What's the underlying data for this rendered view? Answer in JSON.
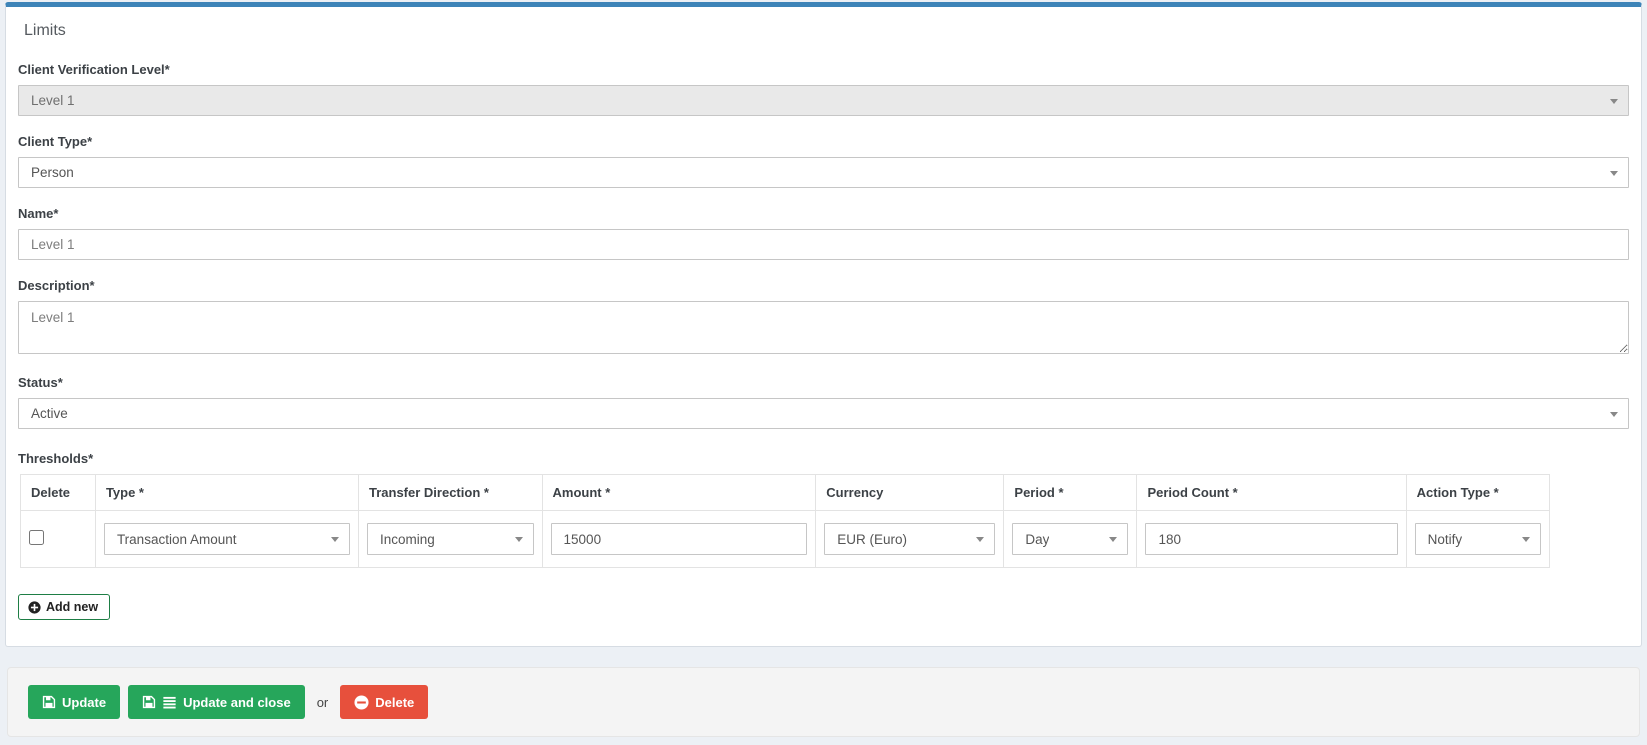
{
  "page": {
    "title": "Limits"
  },
  "colors": {
    "accent_blue": "#3d84b8",
    "success_green": "#26a65b",
    "danger_red": "#e7503c",
    "add_new_border_green": "#1e7e45",
    "page_background": "#ecf0f5",
    "footer_background": "#f4f4f4",
    "disabled_field_background": "#e9e9e9"
  },
  "fields": [
    {
      "label": "Client Verification Level*",
      "type": "select",
      "value": "Level 1",
      "disabled": true
    },
    {
      "label": "Client Type*",
      "type": "select",
      "value": "Person",
      "disabled": false
    },
    {
      "label": "Name*",
      "type": "text",
      "value": "Level 1"
    },
    {
      "label": "Description*",
      "type": "textarea",
      "value": "Level 1"
    },
    {
      "label": "Status*",
      "type": "select",
      "value": "Active",
      "disabled": false
    }
  ],
  "thresholds": {
    "label": "Thresholds*",
    "columns": [
      "Delete",
      "Type *",
      "Transfer Direction *",
      "Amount *",
      "Currency",
      "Period *",
      "Period Count *",
      "Action Type *"
    ],
    "rows": [
      {
        "delete_checked": false,
        "type": "Transaction Amount",
        "transfer_direction": "Incoming",
        "amount": "15000",
        "currency": "EUR (Euro)",
        "period": "Day",
        "period_count": "180",
        "action_type": "Notify"
      }
    ],
    "add_new_label": "Add new"
  },
  "footer": {
    "update_label": "Update",
    "update_close_label": "Update and close",
    "or_label": "or",
    "delete_label": "Delete"
  },
  "icons": {
    "select_caret": "chevron-down",
    "add_new": "plus-circle",
    "update": "save-floppy",
    "update_close": "save-floppy + list",
    "delete": "minus-circle"
  }
}
